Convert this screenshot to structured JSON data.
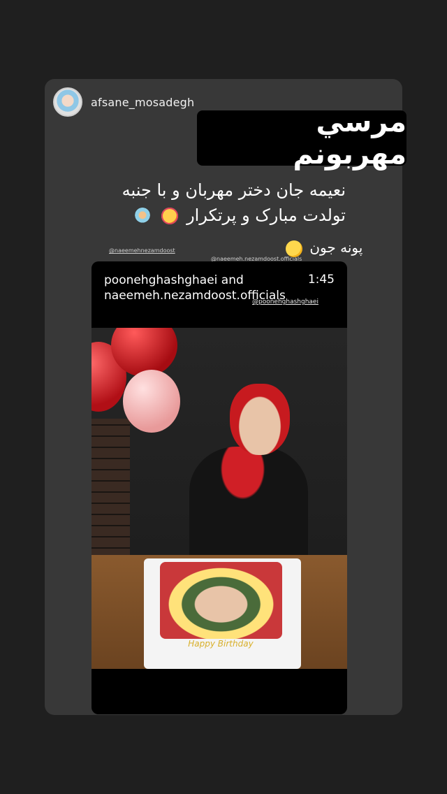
{
  "story": {
    "username": "afsane_mosadegh",
    "thanks_text": "مرسي مهربونم",
    "caption_line1": "نعیمه جان دختر مهربان و با جنبه",
    "caption_line2": "تولدت مبارک و پرتکرار",
    "poneh_text": "پونه جون",
    "mention_1": "@naeemehnezamdoost",
    "mention_2": "@naeemeh.nezamdoost.officials"
  },
  "shared_post": {
    "title": "poonehghashghaei and naeemeh.nezamdoost.officials",
    "time": "1:45",
    "mention": "@poonehghashghaei",
    "cake_text": "Happy Birthday"
  }
}
